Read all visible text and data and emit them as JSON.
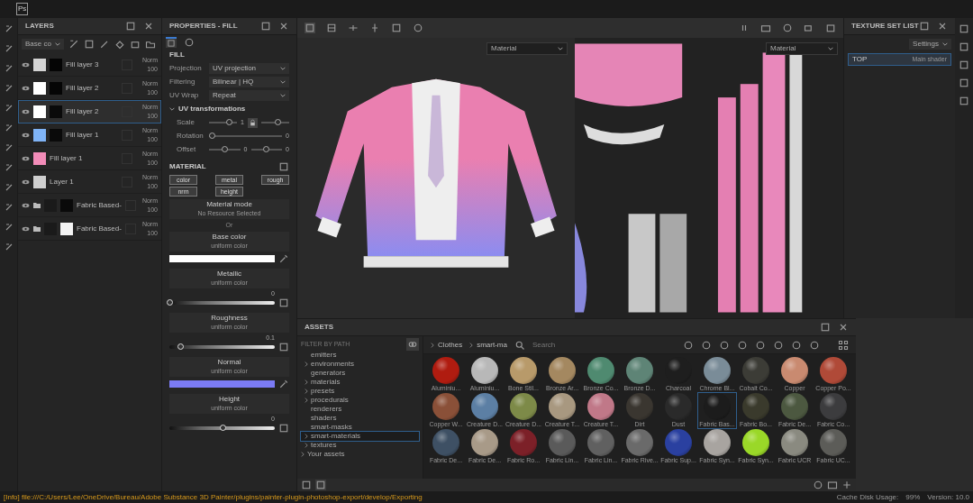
{
  "app": {
    "logo": "Ps"
  },
  "layers": {
    "title": "LAYERS",
    "blend_select": "Base co",
    "items": [
      {
        "name": "Fill layer 3",
        "color": "#d4d4d4",
        "folder": false,
        "mask": {
          "color": "#050505"
        },
        "blend": "Norm",
        "opacity": "100",
        "selected": false
      },
      {
        "name": "Fill layer 2",
        "color": "#ffffff",
        "folder": false,
        "mask": {
          "color": "#050505"
        },
        "blend": "Norm",
        "opacity": "100",
        "selected": false
      },
      {
        "name": "Fill layer 2",
        "color": "#ffffff",
        "folder": false,
        "mask": {
          "color": "#0a0a0a"
        },
        "blend": "Norm",
        "opacity": "100",
        "selected": true
      },
      {
        "name": "Fill layer 1",
        "color": "#7fb3f5",
        "folder": false,
        "mask": {
          "color": "#0a0a0a"
        },
        "blend": "Norm",
        "opacity": "100",
        "selected": false
      },
      {
        "name": "Fill layer 1",
        "color": "#f28cb8",
        "folder": false,
        "blend": "Norm",
        "opacity": "100",
        "selected": false
      },
      {
        "name": "Layer 1",
        "color": "#cfcfcf",
        "folder": false,
        "blend": "Norm",
        "opacity": "100",
        "selected": false
      },
      {
        "name": "Fabric Based-",
        "color": "#1a1a1a",
        "folder": true,
        "mask": {
          "color": "#0a0a0a"
        },
        "blend": "Norm",
        "opacity": "100",
        "selected": false
      },
      {
        "name": "Fabric Based-",
        "color": "#1a1a1a",
        "folder": true,
        "mask": {
          "color": "#f4f4f4"
        },
        "blend": "Norm",
        "opacity": "100",
        "selected": false
      }
    ]
  },
  "properties": {
    "title": "PROPERTIES - FILL",
    "fill_heading": "FILL",
    "dropdowns": [
      {
        "label": "Projection",
        "value": "UV projection"
      },
      {
        "label": "Filtering",
        "value": "Bilinear | HQ"
      },
      {
        "label": "UV Wrap",
        "value": "Repeat"
      }
    ],
    "uv": {
      "title": "UV transformations",
      "expanded": true,
      "scale_label": "Scale",
      "scale_value": "1",
      "rotation_label": "Rotation",
      "rotation_value": "0",
      "offset_label": "Offset",
      "offset_u": "0",
      "offset_v": "0"
    },
    "material_heading": "MATERIAL",
    "channels": [
      {
        "label": "color",
        "on": true
      },
      {
        "label": "metal",
        "on": true
      },
      {
        "label": "rough",
        "on": true
      },
      {
        "label": "nrm",
        "on": true
      },
      {
        "label": "height",
        "on": true
      }
    ],
    "material_mode": {
      "title": "Material mode",
      "value": "No Resource Selected"
    },
    "or": "Or",
    "params": [
      {
        "kind": "swatch",
        "name": "Base color",
        "source": "uniform color",
        "color": "#ffffff"
      },
      {
        "kind": "slider",
        "name": "Metallic",
        "source": "uniform color",
        "value": "0",
        "level": 0
      },
      {
        "kind": "slider",
        "name": "Roughness",
        "source": "uniform color",
        "value": "0.1",
        "level": 0.1
      },
      {
        "kind": "swatch",
        "name": "Normal",
        "source": "uniform color",
        "color": "#7b7bf5"
      },
      {
        "kind": "slider",
        "name": "Height",
        "source": "uniform color",
        "value": "0",
        "level": 0.5
      }
    ]
  },
  "viewport": {
    "view_3d_mode": "Material",
    "view_2d_mode": "Material"
  },
  "texture_sets": {
    "title": "TEXTURE SET LIST",
    "settings": "Settings",
    "items": [
      {
        "name": "TOP",
        "shader": "Main shader",
        "selected": true
      }
    ]
  },
  "assets": {
    "title": "ASSETS",
    "filter_label": "FILTER BY PATH",
    "tree": [
      {
        "label": "emitters",
        "has_children": false,
        "selected": false
      },
      {
        "label": "environments",
        "has_children": true,
        "selected": false
      },
      {
        "label": "generators",
        "has_children": false,
        "selected": false
      },
      {
        "label": "materials",
        "has_children": true,
        "selected": false
      },
      {
        "label": "presets",
        "has_children": true,
        "selected": false
      },
      {
        "label": "procedurals",
        "has_children": true,
        "selected": false
      },
      {
        "label": "renderers",
        "has_children": false,
        "selected": false
      },
      {
        "label": "shaders",
        "has_children": false,
        "selected": false
      },
      {
        "label": "smart-masks",
        "has_children": false,
        "selected": false
      },
      {
        "label": "smart-materials",
        "has_children": true,
        "selected": true
      },
      {
        "label": "textures",
        "has_children": true,
        "selected": false
      }
    ],
    "your_assets": "Your assets",
    "breadcrumbs": [
      "Clothes",
      "smart-ma"
    ],
    "search_placeholder": "Search",
    "materials": [
      {
        "name": "Aluminiu...",
        "color": "#b01c10",
        "selected": false
      },
      {
        "name": "Aluminiu...",
        "color": "#b8b8b8",
        "selected": false
      },
      {
        "name": "Bone Stil...",
        "color": "#b89a6a",
        "selected": false
      },
      {
        "name": "Bronze Ar...",
        "color": "#a48860",
        "selected": false
      },
      {
        "name": "Bronze Co...",
        "color": "#4f8a70",
        "selected": false
      },
      {
        "name": "Bronze D...",
        "color": "#5e8476",
        "selected": false
      },
      {
        "name": "Charcoal",
        "color": "#1e1e1e",
        "selected": false
      },
      {
        "name": "Chrome Bl...",
        "color": "#7a8c98",
        "selected": false
      },
      {
        "name": "Cobalt Co...",
        "color": "#3c3c36",
        "selected": false
      },
      {
        "name": "Copper",
        "color": "#c98a70",
        "selected": false
      },
      {
        "name": "Copper Po...",
        "color": "#b04a38",
        "selected": false
      },
      {
        "name": "Copper W...",
        "color": "#8a5038",
        "selected": false
      },
      {
        "name": "Creature D...",
        "color": "#5c7fa4",
        "selected": false
      },
      {
        "name": "Creature D...",
        "color": "#7d8a48",
        "selected": false
      },
      {
        "name": "Creature T...",
        "color": "#a89880",
        "selected": false
      },
      {
        "name": "Creature T...",
        "color": "#c07888",
        "selected": false
      },
      {
        "name": "Dirt",
        "color": "#3a3630",
        "selected": false
      },
      {
        "name": "Dust",
        "color": "#2a2a2a",
        "selected": false
      },
      {
        "name": "Fabric Bas...",
        "color": "#1c1c1c",
        "selected": true
      },
      {
        "name": "Fabric Bo...",
        "color": "#3a3a2c",
        "selected": false
      },
      {
        "name": "Fabric De...",
        "color": "#4c5840",
        "selected": false
      },
      {
        "name": "Fabric Co...",
        "color": "#3c3c3e",
        "selected": false
      },
      {
        "name": "Fabric De...",
        "color": "#3e5064",
        "selected": false
      },
      {
        "name": "Fabric De...",
        "color": "#a89a88",
        "selected": false
      },
      {
        "name": "Fabric Ro...",
        "color": "#7c2028",
        "selected": false
      },
      {
        "name": "Fabric Lin...",
        "color": "#5a5a5a",
        "selected": false
      },
      {
        "name": "Fabric Lin...",
        "color": "#606060",
        "selected": false
      },
      {
        "name": "Fabric Rive...",
        "color": "#6a6a6a",
        "selected": false
      },
      {
        "name": "Fabric Sup...",
        "color": "#2a40a0",
        "selected": false
      },
      {
        "name": "Fabric Syn...",
        "color": "#a8a4a0",
        "selected": false
      },
      {
        "name": "Fabric Syn...",
        "color": "#9ad828",
        "selected": false
      },
      {
        "name": "Fabric UCR",
        "color": "#8a8a80",
        "selected": false
      },
      {
        "name": "Fabric UC...",
        "color": "#5c5c58",
        "selected": false
      }
    ]
  },
  "status_bar": {
    "log": "[Info] file:///C:/Users/Lee/OneDrive/Bureau/Adobe Substance 3D Painter/plugins/painter-plugin-photoshop-export/develop/Exporting",
    "cache": "Cache Disk Usage:",
    "cache_value": "99%",
    "version": "Version: 10.0"
  }
}
